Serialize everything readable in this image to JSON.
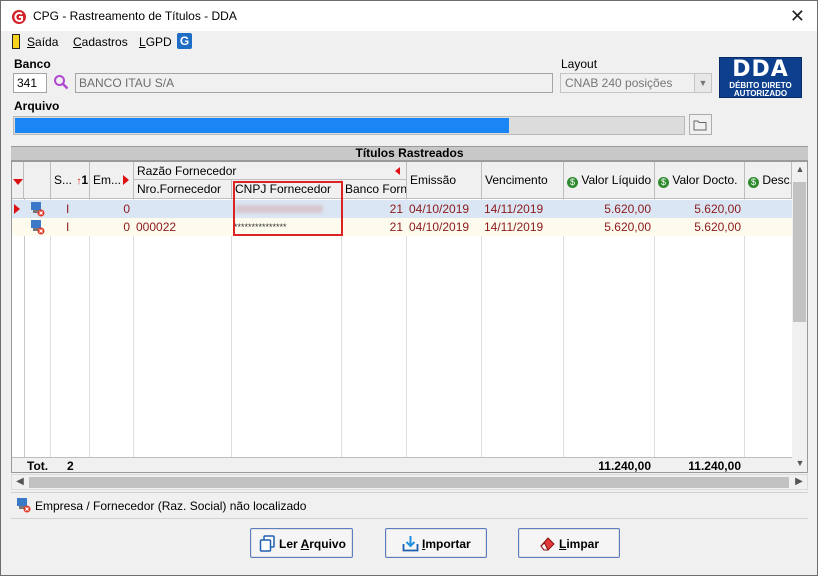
{
  "window": {
    "title": "CPG - Rastreamento de Títulos - DDA",
    "close_glyph": "✕"
  },
  "menu": {
    "items": [
      {
        "label_rest": "aída",
        "label_ul": "S"
      },
      {
        "label_rest": "adastros",
        "label_ul": "C"
      },
      {
        "label_rest": "GPD",
        "label_ul": "L"
      }
    ],
    "lgpd_icon_letter": "G"
  },
  "banco": {
    "label": "Banco",
    "code": "341",
    "name": "BANCO ITAU S/A"
  },
  "layout": {
    "label": "Layout",
    "value": "CNAB 240 posições"
  },
  "dda_logo": {
    "big": "DDA",
    "line1": "DÉBITO DIRETO",
    "line2": "AUTORIZADO"
  },
  "arquivo": {
    "label": "Arquivo",
    "progress_fraction": 0.74
  },
  "grid": {
    "section_title": "Títulos Rastreados",
    "group_header": "Razão Fornecedor",
    "columns": {
      "s": "S...",
      "s_sort": "1",
      "em": "Em...",
      "nro": "Nro.Fornecedor",
      "cnpj": "CNPJ Fornecedor",
      "banco": "Banco Forn.",
      "emissao": "Emissão",
      "vencimento": "Vencimento",
      "valor_liquido": "Valor Líquido",
      "valor_docto": "Valor Docto.",
      "desc": "Desc..."
    },
    "rows": [
      {
        "s": "I",
        "em": "0",
        "nro": "",
        "cnpj": "",
        "banco": "21",
        "emissao": "04/10/2019",
        "vencimento": "14/11/2019",
        "valor_liquido": "5.620,00",
        "valor_docto": "5.620,00"
      },
      {
        "s": "I",
        "em": "0",
        "nro": "000022",
        "cnpj": "***************",
        "banco": "21",
        "emissao": "04/10/2019",
        "vencimento": "14/11/2019",
        "valor_liquido": "5.620,00",
        "valor_docto": "5.620,00"
      }
    ],
    "totals": {
      "label": "Tot.",
      "count": "2",
      "valor_liquido": "11.240,00",
      "valor_docto": "11.240,00"
    }
  },
  "status_message": "Empresa / Fornecedor (Raz. Social) não localizado",
  "buttons": {
    "ler_arquivo": {
      "pre": "Ler ",
      "ul": "A",
      "post": "rquivo"
    },
    "importar": {
      "pre": "",
      "ul": "I",
      "post": "mportar"
    },
    "limpar": {
      "pre": "",
      "ul": "L",
      "post": "impar"
    }
  },
  "colors": {
    "accent_red": "#d11111",
    "selection": "#dae6f4",
    "progress": "#1a86f5",
    "money_icon": "#2e8b2e"
  }
}
